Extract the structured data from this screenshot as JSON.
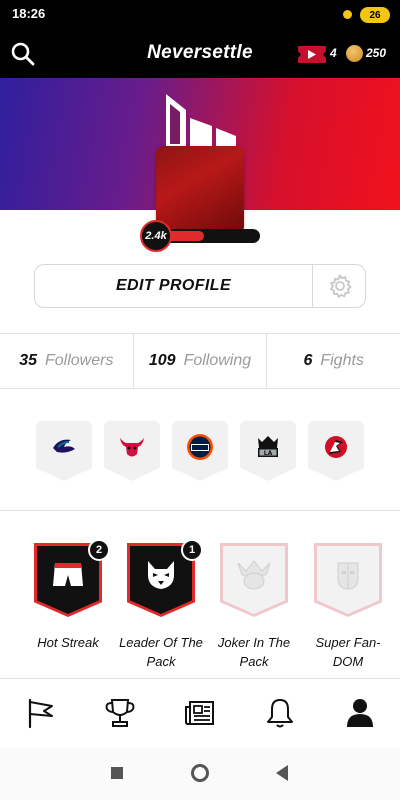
{
  "status_bar": {
    "time": "18:26",
    "battery": "26"
  },
  "header": {
    "title": "Neversettle",
    "tickets": "4",
    "coins": "250"
  },
  "profile": {
    "level": "2.4k",
    "level_progress": 0.45
  },
  "edit_profile": {
    "label": "EDIT PROFILE"
  },
  "stats": [
    {
      "value": "35",
      "label": "Followers"
    },
    {
      "value": "109",
      "label": "Following"
    },
    {
      "value": "6",
      "label": "Fights"
    }
  ],
  "teams": [
    {
      "icon": "hornets-logo-icon"
    },
    {
      "icon": "bulls-logo-icon"
    },
    {
      "icon": "oilers-logo-icon"
    },
    {
      "icon": "kings-logo-icon"
    },
    {
      "icon": "devils-logo-icon"
    }
  ],
  "badges": [
    {
      "name": "Hot Streak",
      "count": "2",
      "locked": false
    },
    {
      "name": "Leader Of The Pack",
      "count": "1",
      "locked": false
    },
    {
      "name": "Joker In The Pack",
      "count": "",
      "locked": true
    },
    {
      "name": "Super Fan-DOM",
      "count": "",
      "locked": true
    }
  ],
  "bottom_nav": [
    {
      "icon": "flag-icon"
    },
    {
      "icon": "trophy-icon"
    },
    {
      "icon": "newspaper-icon"
    },
    {
      "icon": "bell-icon"
    },
    {
      "icon": "profile-icon"
    }
  ],
  "colors": {
    "accent": "#e12a2a",
    "header_bg": "#000000",
    "banner_start": "#2f1f9e",
    "banner_end": "#f1111c"
  }
}
